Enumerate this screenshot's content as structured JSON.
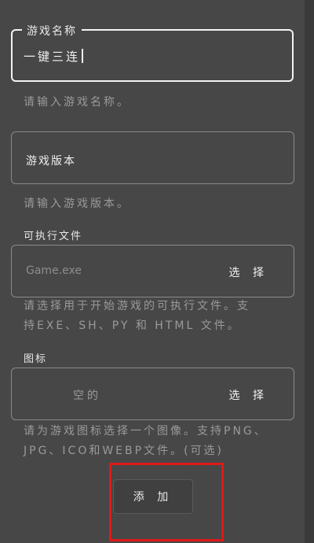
{
  "game_name": {
    "legend": "游戏名称",
    "value": "一键三连",
    "helper": "请输入游戏名称。"
  },
  "game_version": {
    "label": "游戏版本",
    "helper": "请输入游戏版本。"
  },
  "executable": {
    "section_label": "可执行文件",
    "placeholder": "Game.exe",
    "select_label": "选 择",
    "helper_line1": "请选择用于开始游戏的可执行文件。支",
    "helper_line2": "持EXE、SH、PY 和 HTML 文件。"
  },
  "icon": {
    "section_label": "图标",
    "placeholder": "空的",
    "select_label": "选 择",
    "helper_line1": "请为游戏图标选择一个图像。支持PNG、",
    "helper_line2": "JPG、ICO和WEBP文件。(可选)"
  },
  "add_button": {
    "label": "添 加"
  },
  "colors": {
    "background": "#474747",
    "highlight": "#e01818"
  }
}
